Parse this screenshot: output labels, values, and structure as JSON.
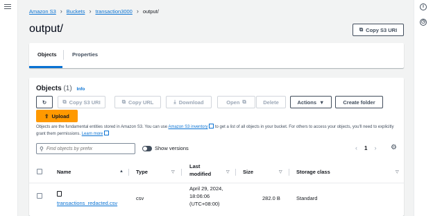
{
  "breadcrumb": {
    "items": [
      "Amazon S3",
      "Buckets",
      "transaction3000"
    ],
    "current": "output/"
  },
  "page": {
    "title": "output/",
    "copy_s3_uri_label": "Copy S3 URI"
  },
  "tabs": {
    "objects": "Objects",
    "properties": "Properties"
  },
  "objects_panel": {
    "title": "Objects",
    "count": "(1)",
    "info": "Info",
    "toolbar": {
      "copy_s3_uri": "Copy S3 URI",
      "copy_url": "Copy URL",
      "download": "Download",
      "open": "Open",
      "delete": "Delete",
      "actions": "Actions",
      "create_folder": "Create folder",
      "upload": "Upload"
    },
    "description": {
      "part1": "Objects are the fundamental entities stored in Amazon S3. You can use ",
      "inventory_link": "Amazon S3 inventory",
      "part2": " to get a list of all objects in your bucket. For others to access your objects, you'll need to explicitly grant them permissions. ",
      "learn_more": "Learn more"
    },
    "search_placeholder": "Find objects by prefix",
    "show_versions": "Show versions",
    "page_number": "1"
  },
  "table": {
    "columns": [
      "Name",
      "Type",
      "Last modified",
      "Size",
      "Storage class"
    ],
    "rows": [
      {
        "name": "transactions_redacted.csv",
        "type": "csv",
        "last_modified_1": "April 29, 2024,",
        "last_modified_2": "18:06:06",
        "last_modified_3": "(UTC+08:00)",
        "size": "282.0 B",
        "storage_class": "Standard"
      }
    ]
  },
  "colors": {
    "link": "#0972d3",
    "primary": "#ff9900",
    "background": "#f2f3f3"
  }
}
